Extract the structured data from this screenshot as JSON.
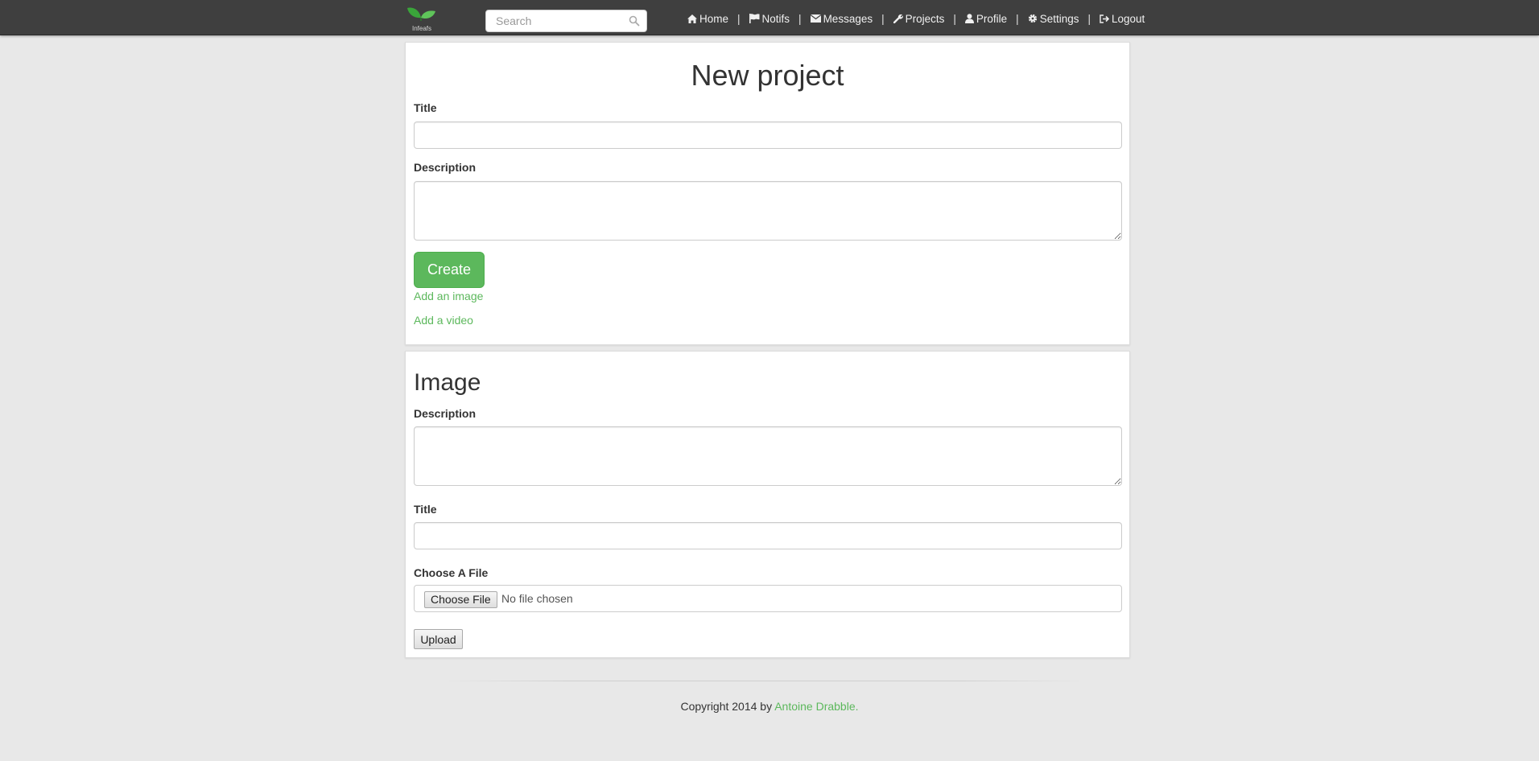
{
  "navbar": {
    "logo_text": "Infeafs",
    "search": {
      "placeholder": "Search",
      "value": ""
    },
    "items": [
      {
        "label": "Home",
        "icon": "home-icon"
      },
      {
        "label": "Notifs",
        "icon": "flag-icon"
      },
      {
        "label": "Messages",
        "icon": "envelope-icon"
      },
      {
        "label": "Projects",
        "icon": "wrench-icon"
      },
      {
        "label": "Profile",
        "icon": "user-icon"
      },
      {
        "label": "Settings",
        "icon": "gear-icon"
      },
      {
        "label": "Logout",
        "icon": "logout-icon"
      }
    ],
    "separator": "|"
  },
  "project_form": {
    "heading": "New project",
    "title_label": "Title",
    "title_value": "",
    "description_label": "Description",
    "description_value": "",
    "create_label": "Create",
    "add_image_link": "Add an image",
    "add_video_link": "Add a video"
  },
  "image_form": {
    "heading": "Image",
    "description_label": "Description",
    "description_value": "",
    "title_label": "Title",
    "title_value": "",
    "file_label": "Choose A File",
    "file_button": "Choose File",
    "file_status": "No file chosen",
    "upload_label": "Upload"
  },
  "footer": {
    "text": "Copyright 2014 by ",
    "author": "Antoine Drabble."
  },
  "colors": {
    "navbar_bg": "#3f3f3f",
    "accent_green": "#5cb85c",
    "page_bg": "#e8e8e8"
  }
}
